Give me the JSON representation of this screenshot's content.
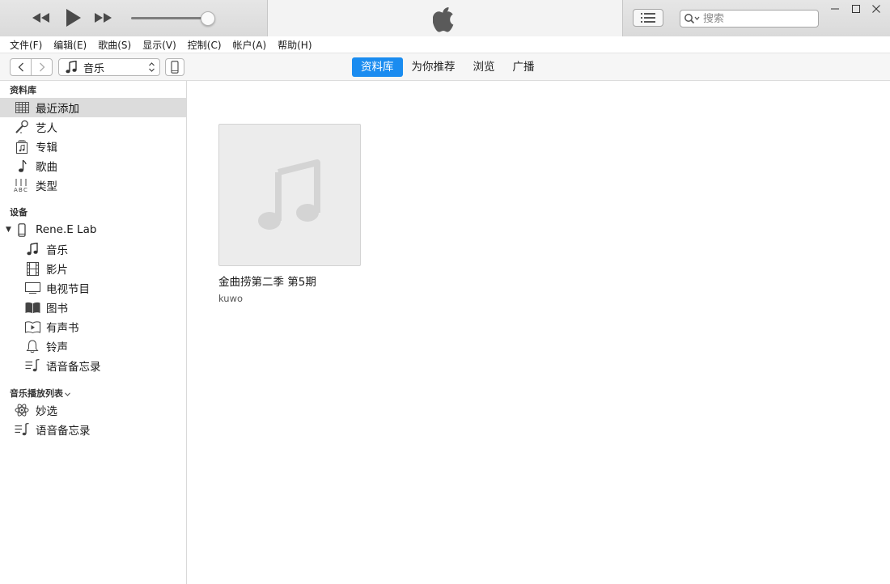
{
  "toolbar": {
    "search_placeholder": "搜索"
  },
  "menu": [
    "文件(F)",
    "编辑(E)",
    "歌曲(S)",
    "显示(V)",
    "控制(C)",
    "帐户(A)",
    "帮助(H)"
  ],
  "nav": {
    "media_type": "音乐",
    "tabs": [
      "资料库",
      "为你推荐",
      "浏览",
      "广播"
    ],
    "active_tab": "资料库"
  },
  "sidebar": {
    "library_header": "资料库",
    "library_items": [
      "最近添加",
      "艺人",
      "专辑",
      "歌曲",
      "类型"
    ],
    "devices_header": "设备",
    "device_name": "Rene.E Lab",
    "device_items": [
      "音乐",
      "影片",
      "电视节目",
      "图书",
      "有声书",
      "铃声",
      "语音备忘录"
    ],
    "playlists_header": "音乐播放列表",
    "playlist_items": [
      "妙选",
      "语音备忘录"
    ]
  },
  "album": {
    "title": "金曲捞第二季 第5期",
    "artist": "kuwo"
  },
  "colors": {
    "accent": "#1a8cf0",
    "selected_row": "#dcdcdc"
  }
}
